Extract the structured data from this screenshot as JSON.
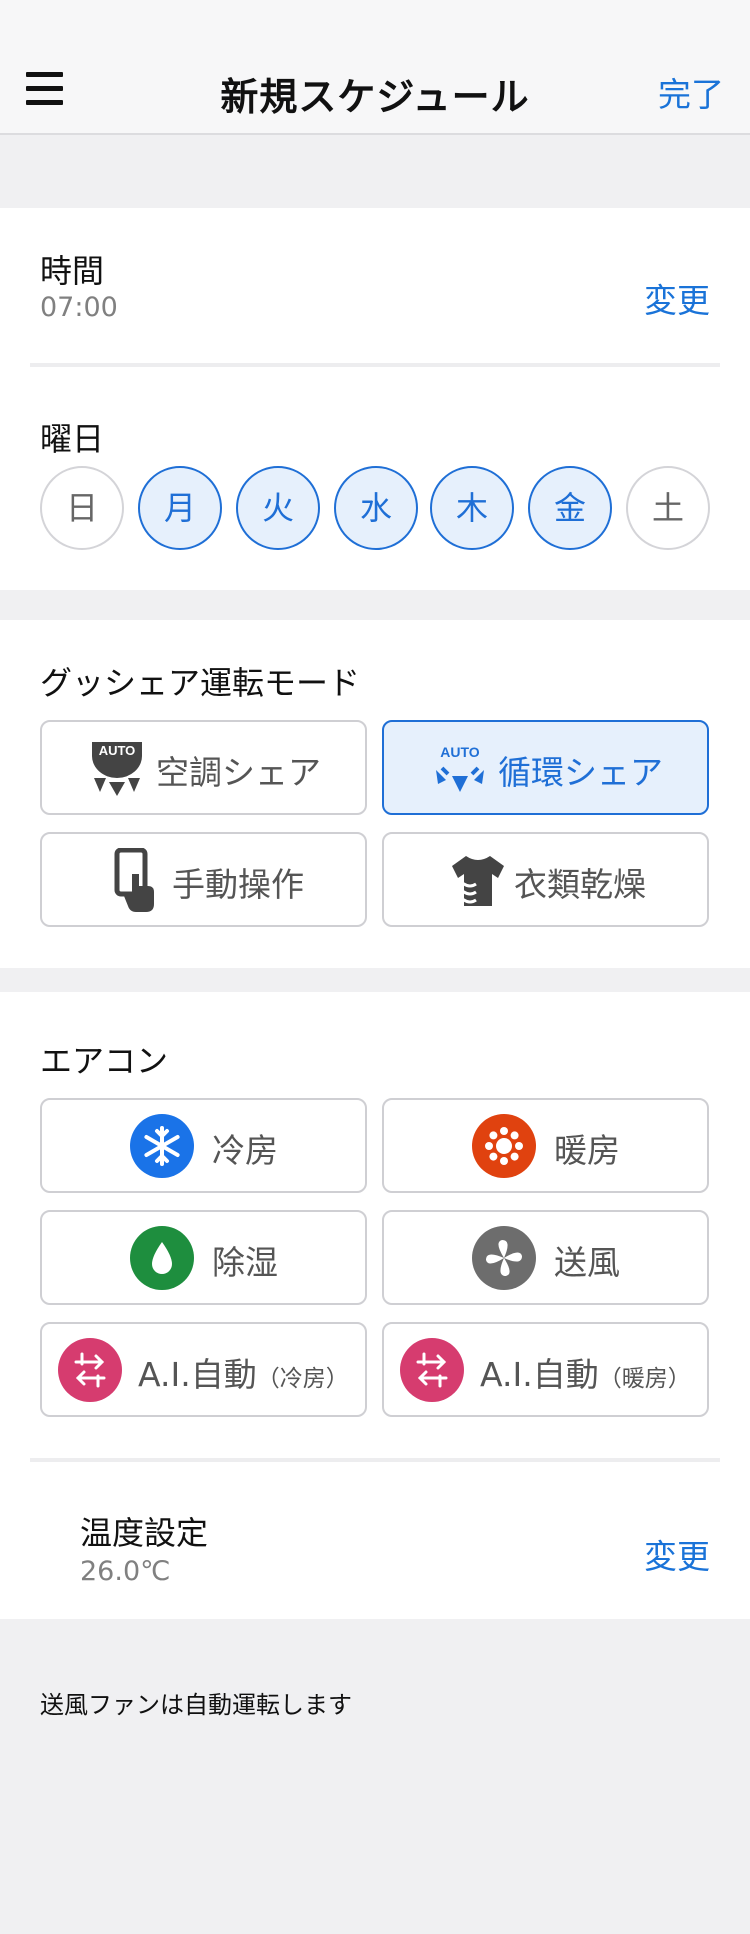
{
  "header": {
    "title": "新規スケジュール",
    "done_label": "完了"
  },
  "time": {
    "label": "時間",
    "value": "07:00",
    "change_label": "変更"
  },
  "days": {
    "label": "曜日",
    "items": [
      {
        "label": "日",
        "selected": false
      },
      {
        "label": "月",
        "selected": true
      },
      {
        "label": "火",
        "selected": true
      },
      {
        "label": "水",
        "selected": true
      },
      {
        "label": "木",
        "selected": true
      },
      {
        "label": "金",
        "selected": true
      },
      {
        "label": "土",
        "selected": false
      }
    ]
  },
  "gush_mode": {
    "label": "グッシェア運転モード",
    "options": [
      {
        "label": "空調シェア",
        "icon": "auto-aircon-share-icon",
        "auto_text": "AUTO",
        "selected": false
      },
      {
        "label": "循環シェア",
        "icon": "auto-circulation-share-icon",
        "auto_text": "AUTO",
        "selected": true
      },
      {
        "label": "手動操作",
        "icon": "manual-hand-icon",
        "selected": false
      },
      {
        "label": "衣類乾燥",
        "icon": "clothes-dry-icon",
        "selected": false
      }
    ]
  },
  "aircon": {
    "label": "エアコン",
    "options": [
      {
        "label": "冷房",
        "icon": "snowflake-icon",
        "color": "#1a73e8"
      },
      {
        "label": "暖房",
        "icon": "sun-icon",
        "color": "#e0420f"
      },
      {
        "label": "除湿",
        "icon": "droplet-icon",
        "color": "#1e8e3e"
      },
      {
        "label": "送風",
        "icon": "fan-icon",
        "color": "#6d6d6d"
      },
      {
        "label": "A.I.自動",
        "sub": "（冷房）",
        "icon": "ai-auto-icon",
        "color": "#d63c6f"
      },
      {
        "label": "A.I.自動",
        "sub": "（暖房）",
        "icon": "ai-auto-icon",
        "color": "#d63c6f"
      }
    ]
  },
  "temperature": {
    "label": "温度設定",
    "value": "26.0℃",
    "change_label": "変更"
  },
  "footer_note": "送風ファンは自動運転します",
  "colors": {
    "accent": "#1f6fd6",
    "link": "#1a73d8",
    "background": "#f0f0f2"
  }
}
